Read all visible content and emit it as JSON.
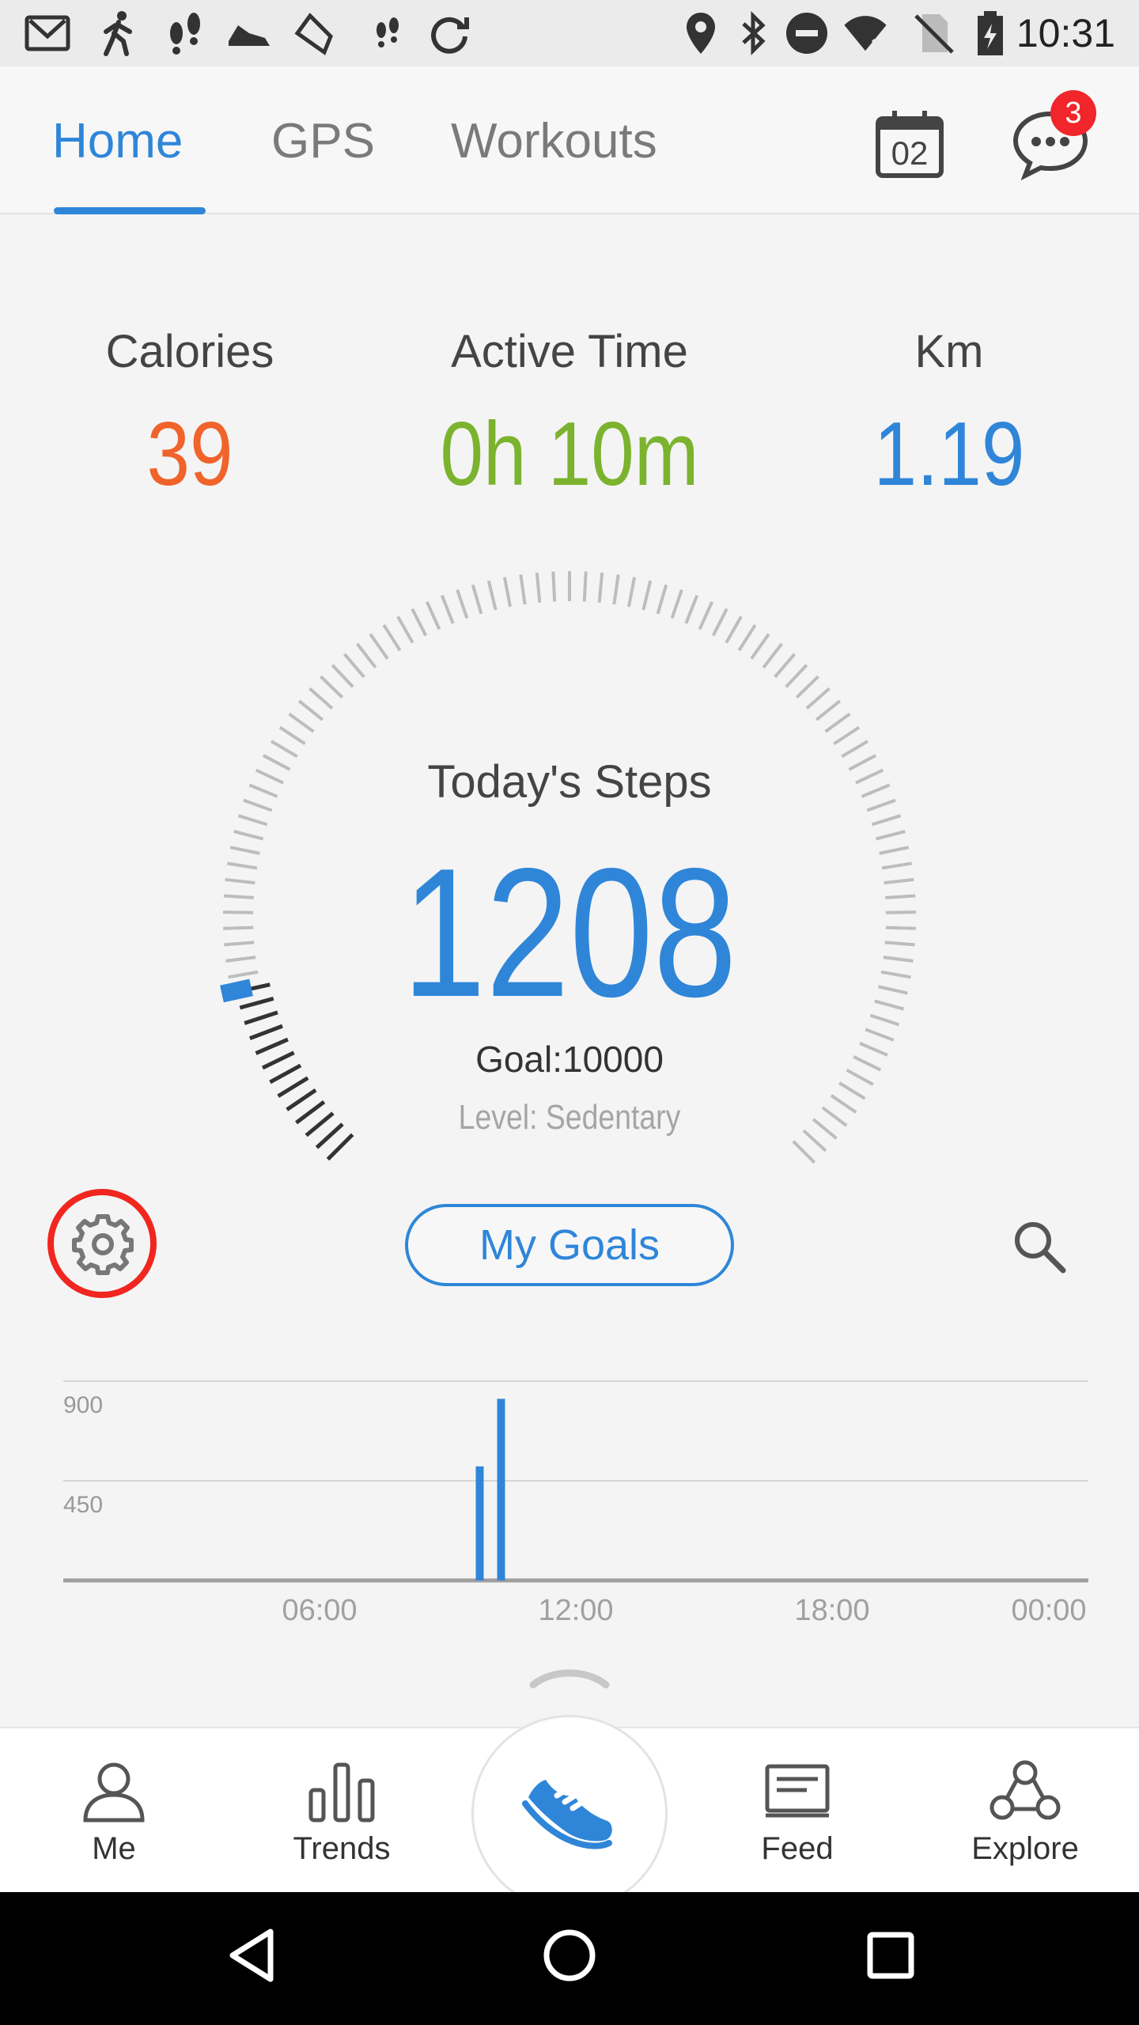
{
  "status_bar": {
    "time": "10:31",
    "left_icons": [
      "gmail-icon",
      "walking-icon",
      "footprints-icon",
      "shoe-icon",
      "sneaker-icon",
      "small-footprints-icon",
      "sync-icon"
    ],
    "right_icons": [
      "location-icon",
      "bluetooth-icon",
      "do-not-disturb-icon",
      "wifi-icon",
      "no-sim-icon",
      "battery-icon"
    ]
  },
  "header": {
    "tabs": [
      {
        "label": "Home",
        "active": true
      },
      {
        "label": "GPS",
        "active": false
      },
      {
        "label": "Workouts",
        "active": false
      }
    ],
    "calendar_day": "02",
    "message_badge": "3"
  },
  "stats": {
    "calories": {
      "label": "Calories",
      "value": "39",
      "color": "#f0632b"
    },
    "active_time": {
      "label": "Active Time",
      "value": "0h 10m",
      "color": "#7bb32e"
    },
    "distance": {
      "label": "Km",
      "value": "1.19",
      "color": "#2f86d8"
    }
  },
  "steps": {
    "label": "Today's Steps",
    "value": "1208",
    "goal_text": "Goal:10000",
    "level_text": "Level: Sedentary",
    "progress_fraction": 0.1208
  },
  "controls": {
    "my_goals_label": "My Goals"
  },
  "hourly_chart": {
    "type": "bar",
    "y_ticks": [
      "900",
      "450"
    ],
    "x_ticks": [
      "06:00",
      "12:00",
      "18:00",
      "00:00"
    ],
    "ylim": [
      0,
      900
    ],
    "bars": [
      {
        "hour": 9.75,
        "value": 515
      },
      {
        "hour": 10.25,
        "value": 820
      }
    ]
  },
  "bottom_nav": {
    "items": [
      {
        "label": "Me",
        "icon": "person-icon"
      },
      {
        "label": "Trends",
        "icon": "bar-chart-icon"
      },
      {
        "label": "Feed",
        "icon": "feed-icon"
      },
      {
        "label": "Explore",
        "icon": "network-icon"
      }
    ],
    "center_icon": "running-shoe-icon"
  },
  "colors": {
    "accent": "#2f86d8",
    "highlight": "#f0261f"
  }
}
